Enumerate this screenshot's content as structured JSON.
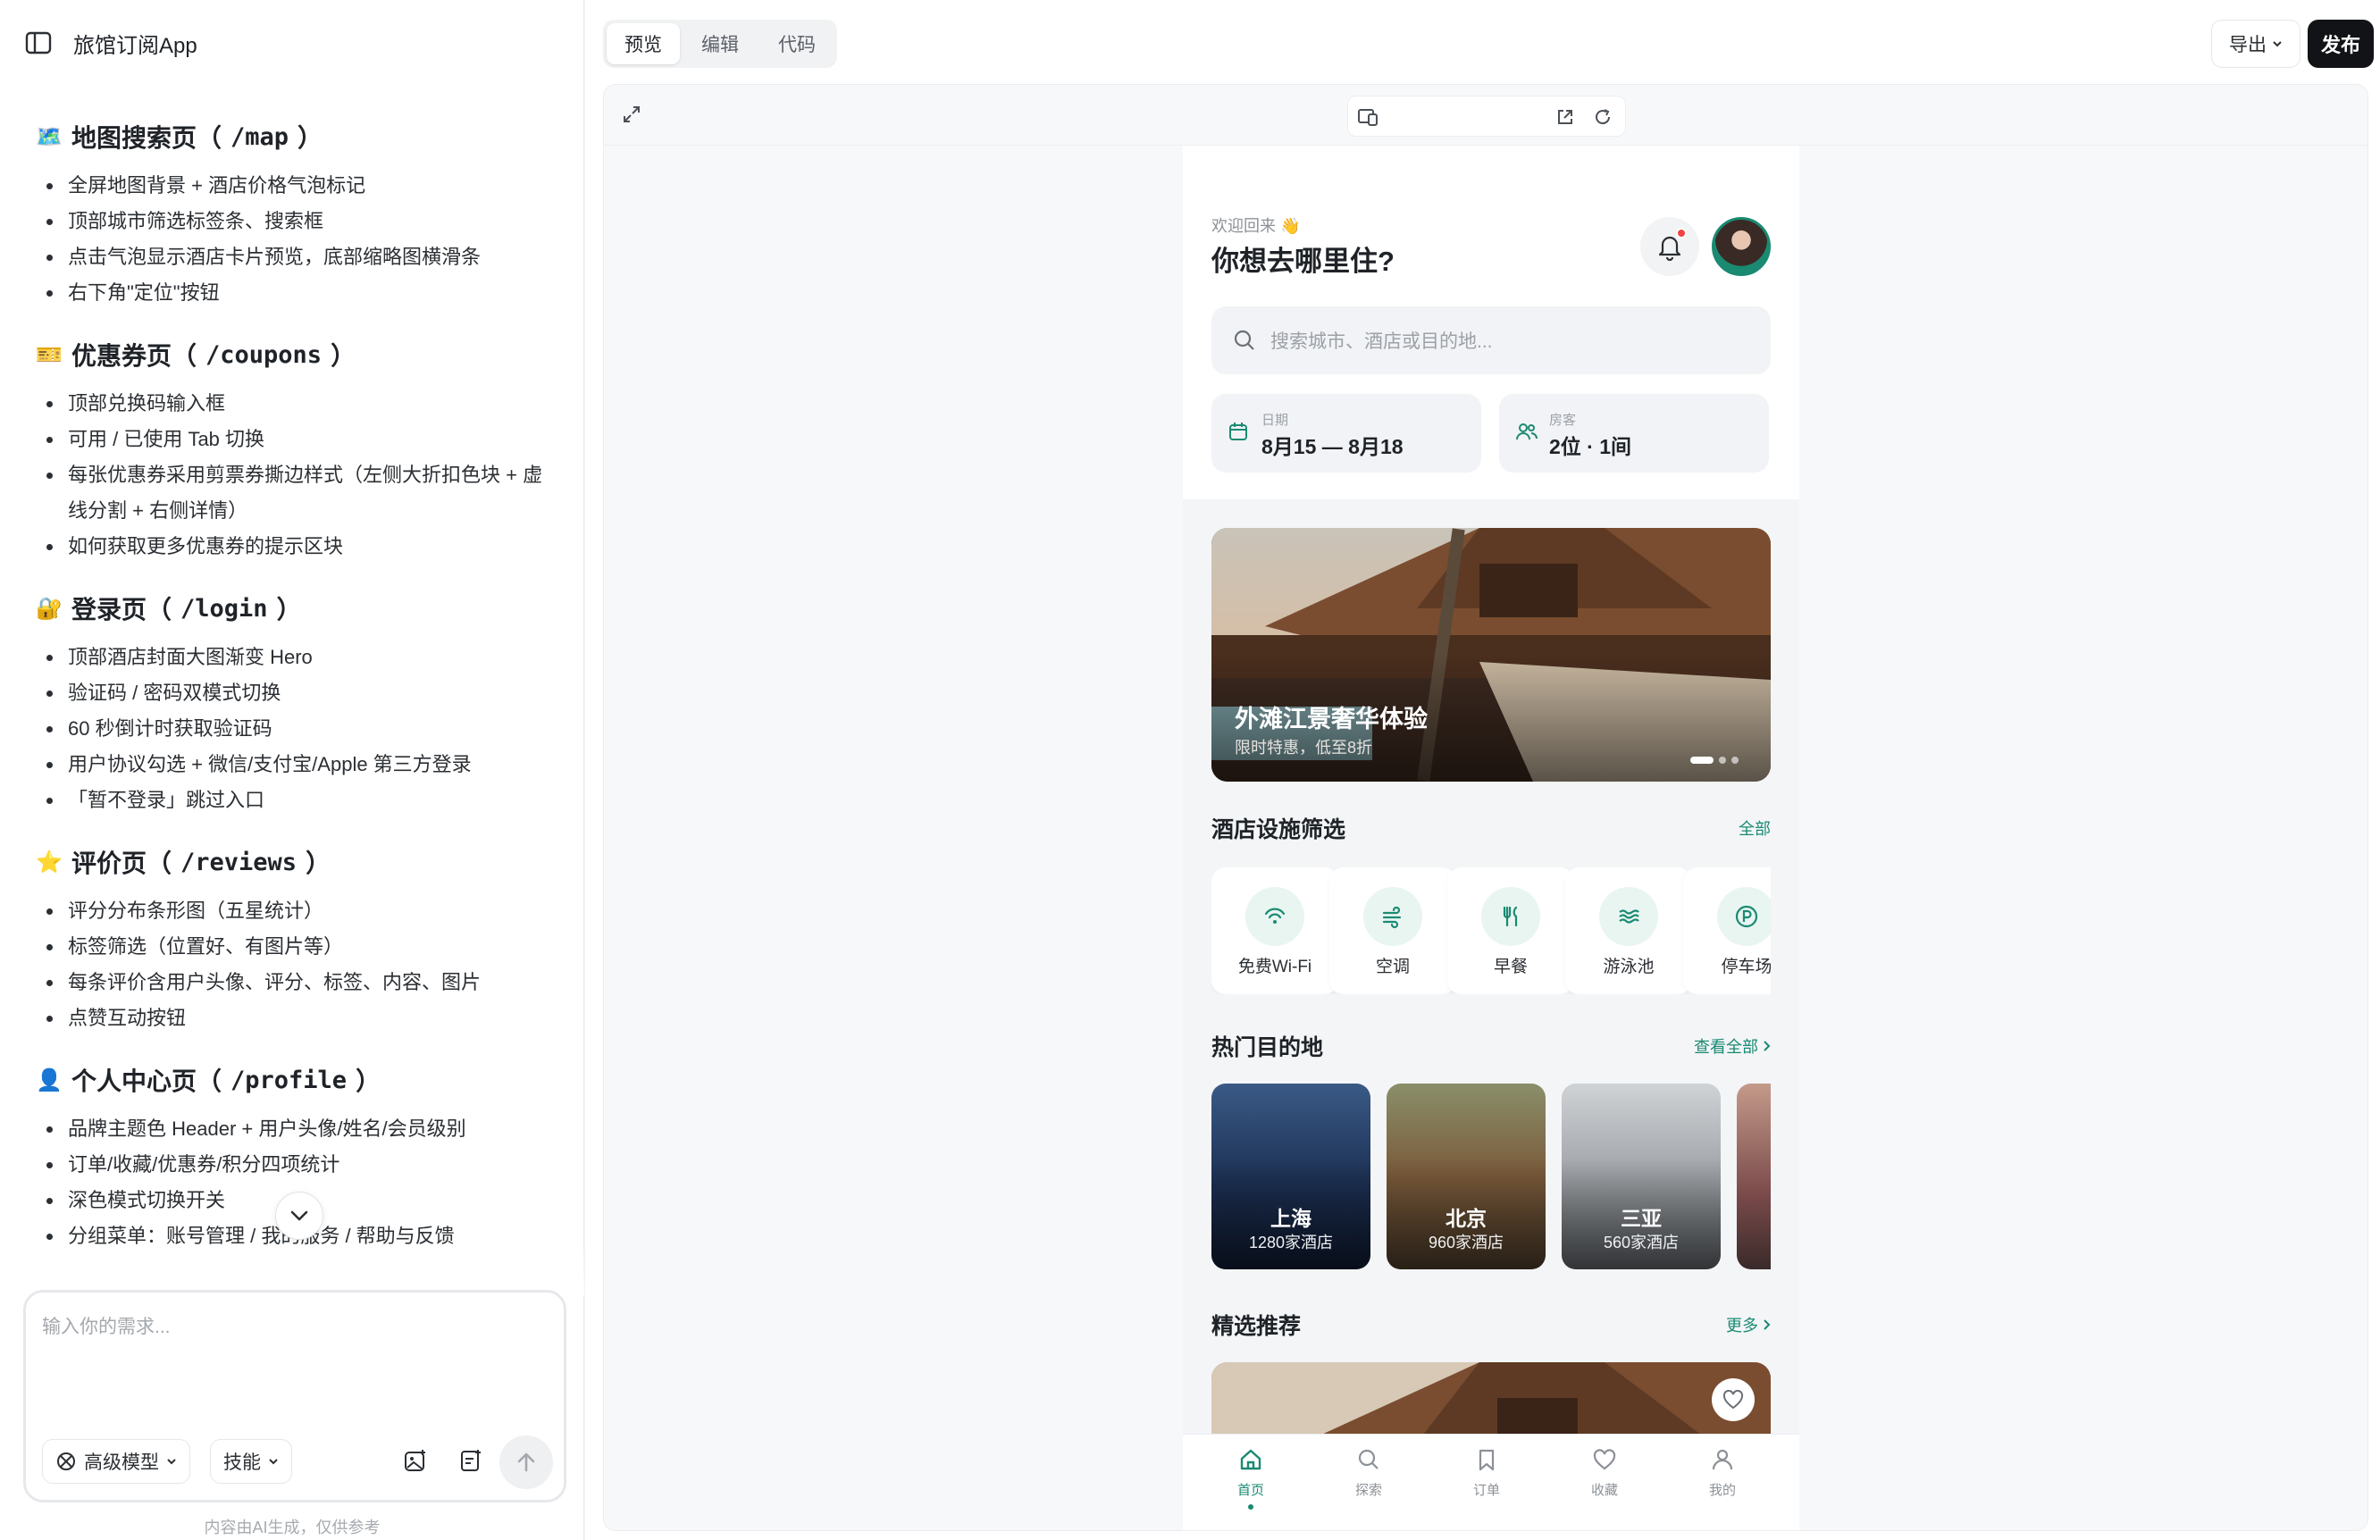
{
  "app": {
    "title": "旅馆订阅App"
  },
  "sections": [
    {
      "emoji": "🗺️",
      "title": "地图搜索页（",
      "path": "/map",
      "close": "）",
      "items": [
        "全屏地图背景 + 酒店价格气泡标记",
        "顶部城市筛选标签条、搜索框",
        "点击气泡显示酒店卡片预览，底部缩略图横滑条",
        "右下角\"定位\"按钮"
      ]
    },
    {
      "emoji": "🎫",
      "title": "优惠券页（",
      "path": "/coupons",
      "close": "）",
      "items": [
        "顶部兑换码输入框",
        "可用 / 已使用 Tab 切换",
        "每张优惠券采用剪票券撕边样式（左侧大折扣色块 + 虚线分割 + 右侧详情）",
        "如何获取更多优惠券的提示区块"
      ]
    },
    {
      "emoji": "🔐",
      "title": "登录页（",
      "path": "/login",
      "close": "）",
      "items": [
        "顶部酒店封面大图渐变 Hero",
        "验证码 / 密码双模式切换",
        "60 秒倒计时获取验证码",
        "用户协议勾选 + 微信/支付宝/Apple 第三方登录",
        "「暂不登录」跳过入口"
      ]
    },
    {
      "emoji": "⭐",
      "title": "评价页（",
      "path": "/reviews",
      "close": "）",
      "items": [
        "评分分布条形图（五星统计）",
        "标签筛选（位置好、有图片等）",
        "每条评价含用户头像、评分、标签、内容、图片",
        "点赞互动按钮"
      ]
    },
    {
      "emoji": "👤",
      "title": "个人中心页（",
      "path": "/profile",
      "close": "）",
      "items": [
        "品牌主题色 Header + 用户头像/姓名/会员级别",
        "订单/收藏/优惠券/积分四项统计",
        "深色模式切换开关",
        "分组菜单：账号管理 / 我的服务 / 帮助与反馈"
      ]
    }
  ],
  "composer": {
    "placeholder": "输入你的需求...",
    "model_label": "高级模型",
    "skills_label": "技能",
    "disclaimer": "内容由AI生成，仅供参考"
  },
  "toolbar": {
    "tabs": [
      "预览",
      "编辑",
      "代码"
    ],
    "active_tab": "预览",
    "export_label": "导出",
    "publish_label": "发布"
  },
  "phone": {
    "welcome": "欢迎回来 👋",
    "headline": "你想去哪里住?",
    "search_placeholder": "搜索城市、酒店或目的地...",
    "date": {
      "label": "日期",
      "value": "8月15 — 8月18"
    },
    "guests": {
      "label": "房客",
      "value": "2位 · 1间"
    },
    "banner": {
      "title": "外滩江景奢华体验",
      "subtitle": "限时特惠，低至8折"
    },
    "facilities_title": "酒店设施筛选",
    "facilities_link": "全部",
    "facilities": [
      {
        "label": "免费Wi-Fi",
        "icon": "wifi-icon"
      },
      {
        "label": "空调",
        "icon": "wind-icon"
      },
      {
        "label": "早餐",
        "icon": "utensils-icon"
      },
      {
        "label": "游泳池",
        "icon": "waves-icon"
      },
      {
        "label": "停车场",
        "icon": "parking-icon"
      }
    ],
    "destinations_title": "热门目的地",
    "destinations_link": "查看全部",
    "destinations": [
      {
        "name": "上海",
        "count": "1280家酒店"
      },
      {
        "name": "北京",
        "count": "960家酒店"
      },
      {
        "name": "三亚",
        "count": "560家酒店"
      }
    ],
    "featured_title": "精选推荐",
    "featured_link": "更多",
    "nav": [
      "首页",
      "探索",
      "订单",
      "收藏",
      "我的"
    ],
    "colors": {
      "brand": "#1a8a72",
      "alert": "#ef4444"
    }
  }
}
